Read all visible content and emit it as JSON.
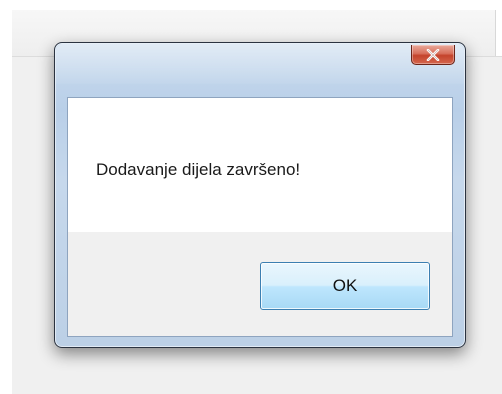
{
  "dialog": {
    "message": "Dodavanje dijela završeno!",
    "ok_label": "OK",
    "close_icon": "close-icon",
    "colors": {
      "frame": "#c6d8ec",
      "close_button": "#c4432c",
      "ok_button_border": "#3c7fb1",
      "button_area": "#f0f0f0"
    }
  }
}
